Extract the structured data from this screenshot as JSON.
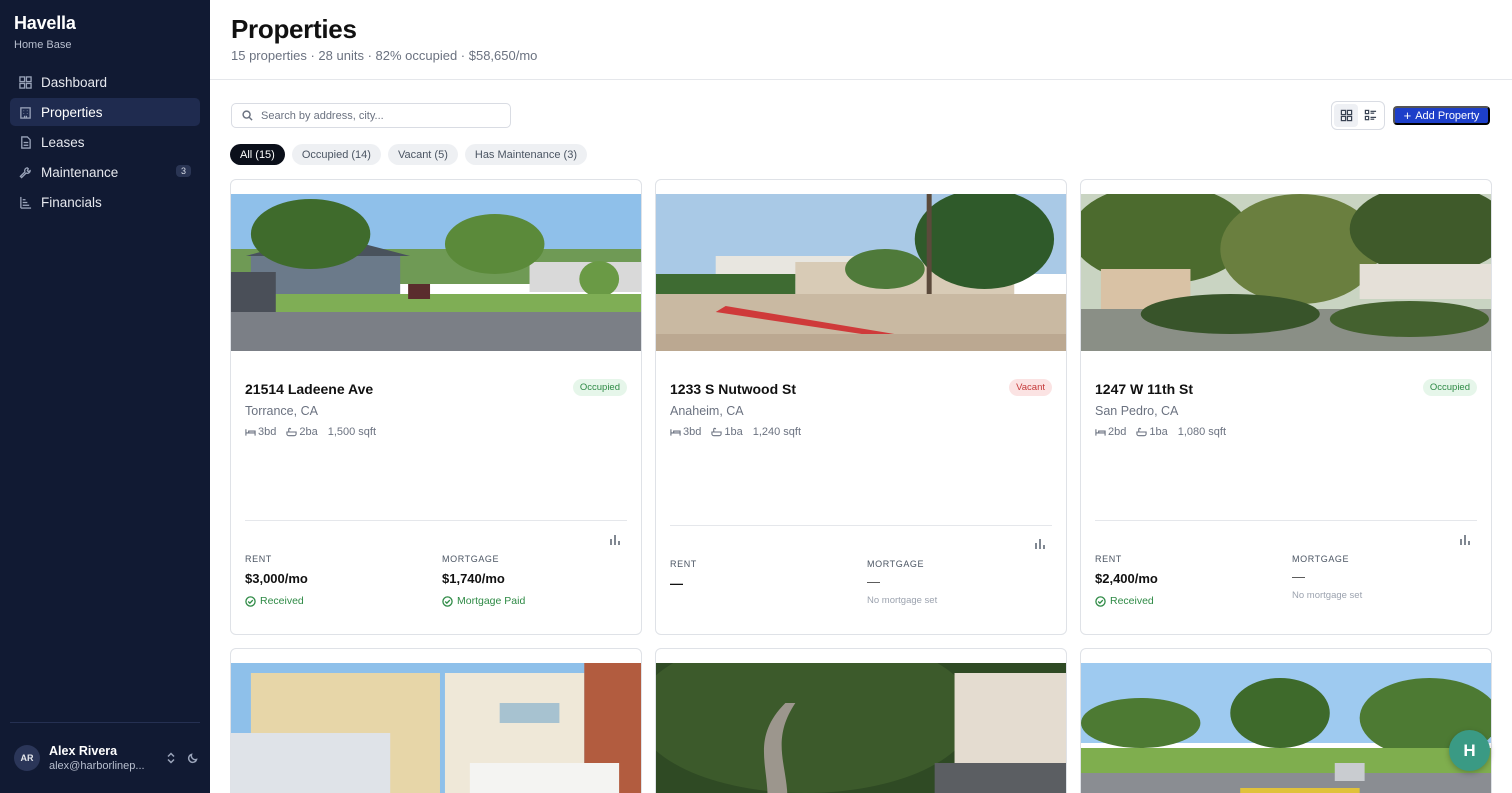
{
  "app": {
    "name": "Havella",
    "subtitle": "Home Base"
  },
  "sidebar": {
    "items": [
      {
        "label": "Dashboard",
        "icon": "dashboard-icon"
      },
      {
        "label": "Properties",
        "icon": "building-icon",
        "active": true
      },
      {
        "label": "Leases",
        "icon": "document-icon"
      },
      {
        "label": "Maintenance",
        "icon": "wrench-icon",
        "badge": "3"
      },
      {
        "label": "Financials",
        "icon": "bar-chart-icon"
      }
    ],
    "user": {
      "initials": "AR",
      "name": "Alex Rivera",
      "email": "alex@harborlinep..."
    }
  },
  "header": {
    "title": "Properties",
    "subtitle": "15 properties · 28 units · 82% occupied · $58,650/mo"
  },
  "toolbar": {
    "search_placeholder": "Search by address, city...",
    "add_label": "Add Property",
    "filters": [
      {
        "label": "All (15)",
        "active": true
      },
      {
        "label": "Occupied (14)"
      },
      {
        "label": "Vacant (5)"
      },
      {
        "label": "Has Maintenance (3)"
      }
    ]
  },
  "labels": {
    "rent": "RENT",
    "mortgage": "MORTGAGE"
  },
  "properties": [
    {
      "address": "21514 Ladeene Ave",
      "city": "Torrance, CA",
      "status": "Occupied",
      "beds": "3bd",
      "baths": "2ba",
      "sqft": "1,500 sqft",
      "rent": "$3,000/mo",
      "rent_status": "Received",
      "mortgage": "$1,740/mo",
      "mortgage_status": "Mortgage Paid"
    },
    {
      "address": "1233 S Nutwood St",
      "city": "Anaheim, CA",
      "status": "Vacant",
      "beds": "3bd",
      "baths": "1ba",
      "sqft": "1,240 sqft",
      "rent": "—",
      "mortgage": "—",
      "mortgage_note": "No mortgage set"
    },
    {
      "address": "1247 W 11th St",
      "city": "San Pedro, CA",
      "status": "Occupied",
      "beds": "2bd",
      "baths": "1ba",
      "sqft": "1,080 sqft",
      "rent": "$2,400/mo",
      "rent_status": "Received",
      "mortgage": "—",
      "mortgage_note": "No mortgage set"
    }
  ],
  "fab": {
    "label": "H"
  },
  "colors": {
    "sidebar": "#111a33",
    "accent": "#1d3fc9",
    "occupied": "#2e8a45",
    "vacant": "#c53a3a",
    "fab": "#3a9a84"
  }
}
